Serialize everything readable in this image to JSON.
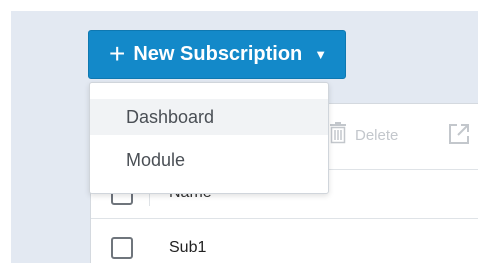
{
  "new_subscription_button": {
    "icon": "plus-icon",
    "label": "New Subscription",
    "caret": "chevron-down-icon"
  },
  "dropdown": {
    "items": [
      {
        "label": "Dashboard"
      },
      {
        "label": "Module"
      }
    ]
  },
  "toolbar": {
    "delete_label": "Delete",
    "delete_icon": "trash-icon",
    "open_icon": "external-link-icon"
  },
  "table": {
    "columns": [
      "Name"
    ],
    "rows": [
      {
        "name": "Sub1"
      }
    ]
  },
  "colors": {
    "accent": "#1389c9",
    "background": "#e3e9f2"
  }
}
